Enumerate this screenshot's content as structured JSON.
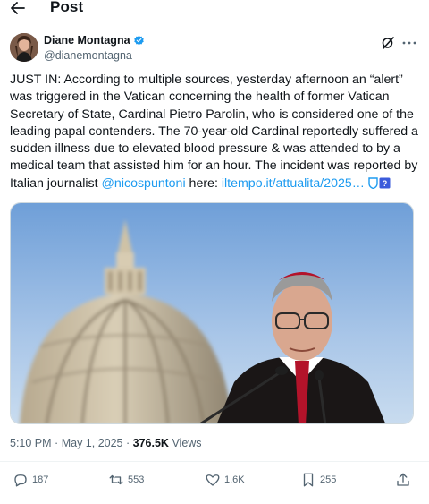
{
  "header": {
    "title": "Post",
    "back_icon": "arrow-left-icon"
  },
  "author": {
    "name": "Diane Montagna",
    "handle": "@dianemontagna",
    "verified": true,
    "verified_color": "#1d9bf0"
  },
  "tweet": {
    "text_main": "JUST IN: According to multiple sources, yesterday afternoon an “alert” was triggered in the Vatican concerning the health of former Vatican Secretary of State, Cardinal Pietro Parolin, who is considered one of the leading papal contenders. The 70-year-old Cardinal reportedly suffered a sudden illness due to elevated blood pressure & was attended to by a medical team that assisted him for an hour. The incident was reported by Italian journalist ",
    "mention": "@nicospuntoni",
    "text_mid": " here: ",
    "link": "iltempo.it/attualita/2025…"
  },
  "meta": {
    "time": "5:10 PM",
    "separator": "·",
    "date": "May 1, 2025",
    "views_count": "376.5K",
    "views_label": "Views"
  },
  "actions": {
    "replies": "187",
    "reposts": "553",
    "likes": "1.6K",
    "bookmarks": "255"
  },
  "colors": {
    "accent": "#1d9bf0",
    "text": "#0f1419",
    "secondary": "#536471"
  }
}
